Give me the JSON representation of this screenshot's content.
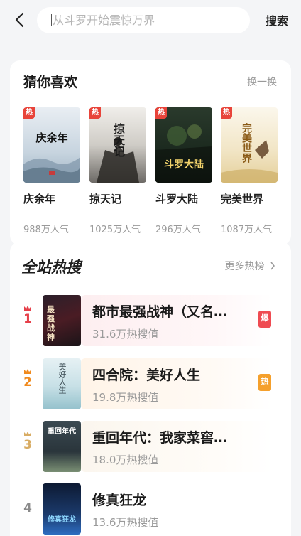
{
  "search": {
    "placeholder": "从斗罗开始震惊万界",
    "button_label": "搜索"
  },
  "guess": {
    "title": "猜你喜欢",
    "refresh_label": "换一换",
    "books": [
      {
        "name": "庆余年",
        "popularity": "988万人气",
        "tag": "热",
        "cover_text": "庆余年"
      },
      {
        "name": "掠天记",
        "popularity": "1025万人气",
        "tag": "热",
        "cover_text": "掠天记"
      },
      {
        "name": "斗罗大陆",
        "popularity": "296万人气",
        "tag": "热",
        "cover_text": "斗罗大陆"
      },
      {
        "name": "完美世界",
        "popularity": "1087万人气",
        "tag": "热",
        "cover_text": "完美世界"
      }
    ]
  },
  "hot": {
    "title": "全站热搜",
    "more_label": "更多热榜",
    "items": [
      {
        "rank": "1",
        "title": "都市最强战神（又名…",
        "count": "31.6万热搜值",
        "badge": "爆",
        "badge_color": "#ef4b52",
        "rank_color": "#e6404a",
        "cover_text": "最强战神"
      },
      {
        "rank": "2",
        "title": "四合院：美好人生",
        "count": "19.8万热搜值",
        "badge": "热",
        "badge_color": "#f5a02c",
        "rank_color": "#f08a1e",
        "cover_text": "美好人生"
      },
      {
        "rank": "3",
        "title": "重回年代：我家菜窖…",
        "count": "18.0万热搜值",
        "badge": "",
        "badge_color": "",
        "rank_color": "#d8ac64",
        "cover_text": "重回年代"
      },
      {
        "rank": "4",
        "title": "修真狂龙",
        "count": "13.6万热搜值",
        "badge": "",
        "badge_color": "",
        "rank_color": "#8a8a8a",
        "cover_text": "修真狂龙"
      }
    ]
  },
  "colors": {
    "accent_red": "#e8443a",
    "muted_text": "#9a9a9a",
    "background": "#f4f5f7"
  },
  "icons": [
    "back-arrow-icon",
    "chevron-right-icon",
    "crown-icon"
  ]
}
